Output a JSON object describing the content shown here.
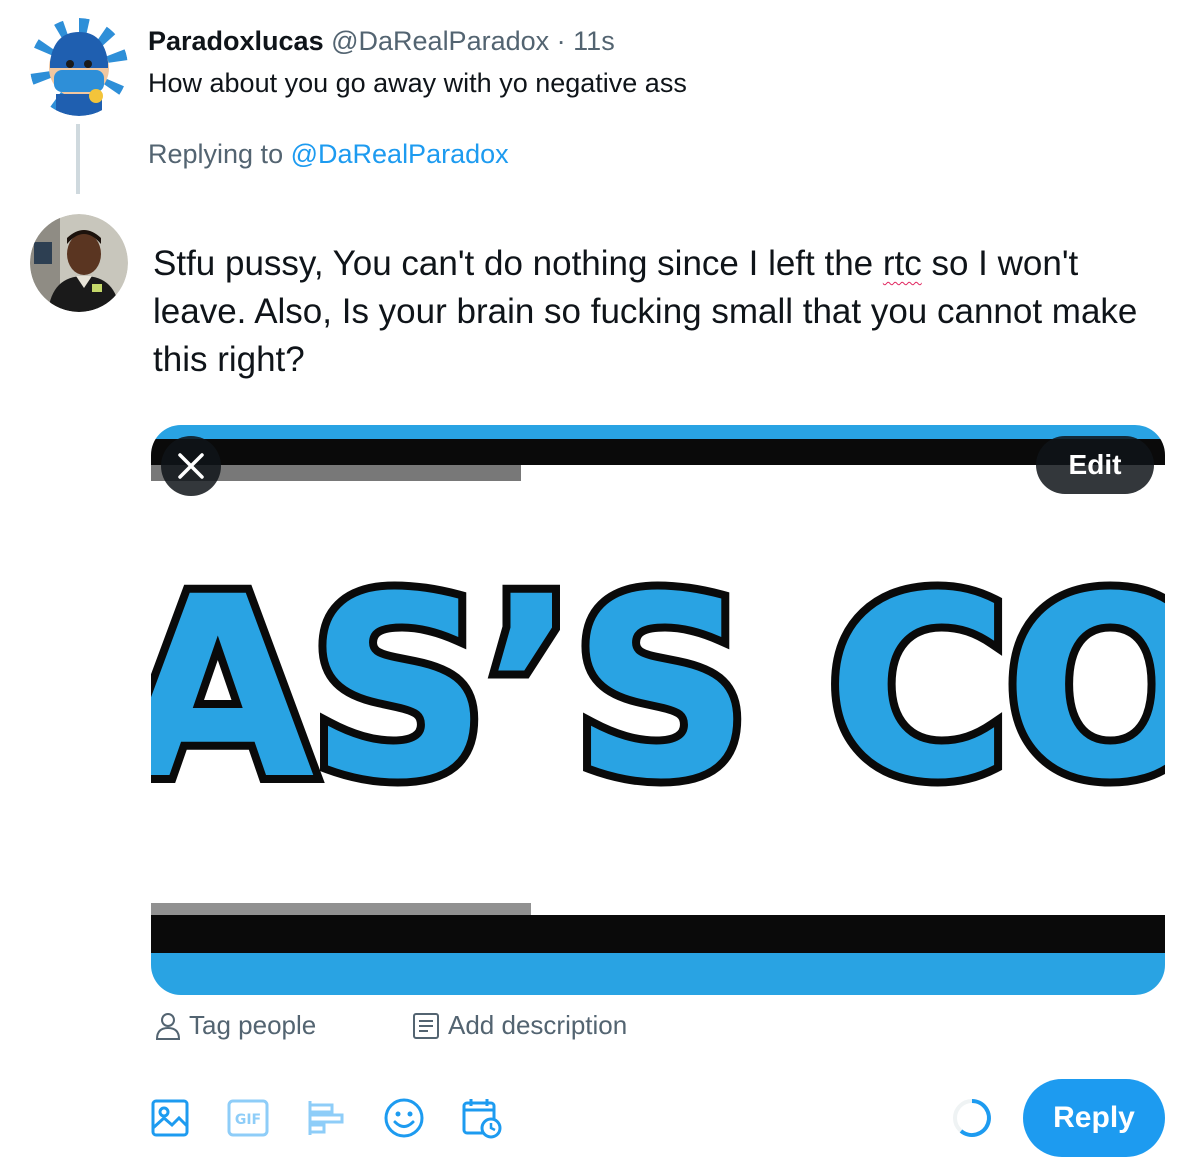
{
  "original_tweet": {
    "display_name": "Paradoxlucas",
    "handle": "@DaRealParadox",
    "separator": "·",
    "time": "11s",
    "text": "How about you go away with yo negative ass"
  },
  "replying": {
    "prefix": "Replying to",
    "mention": "@DaRealParadox"
  },
  "compose": {
    "text_before": "Stfu pussy, You can't do nothing since I left the ",
    "misspelled_word": "rtc",
    "text_after": " so I won't leave. Also, Is your brain so fucking small that you cannot make this right?"
  },
  "media": {
    "edit_label": "Edit",
    "image_text": "AS’S COM",
    "tag_people_label": "Tag people",
    "add_description_label": "Add description"
  },
  "toolbar": {
    "icons": [
      "image-icon",
      "gif-icon",
      "poll-icon",
      "emoji-icon",
      "schedule-icon"
    ],
    "gif_label": "GIF",
    "reply_label": "Reply"
  },
  "colors": {
    "accent": "#1d9bf0",
    "muted": "#536471",
    "banner_blue": "#29a3e3",
    "text": "#0f1419"
  }
}
